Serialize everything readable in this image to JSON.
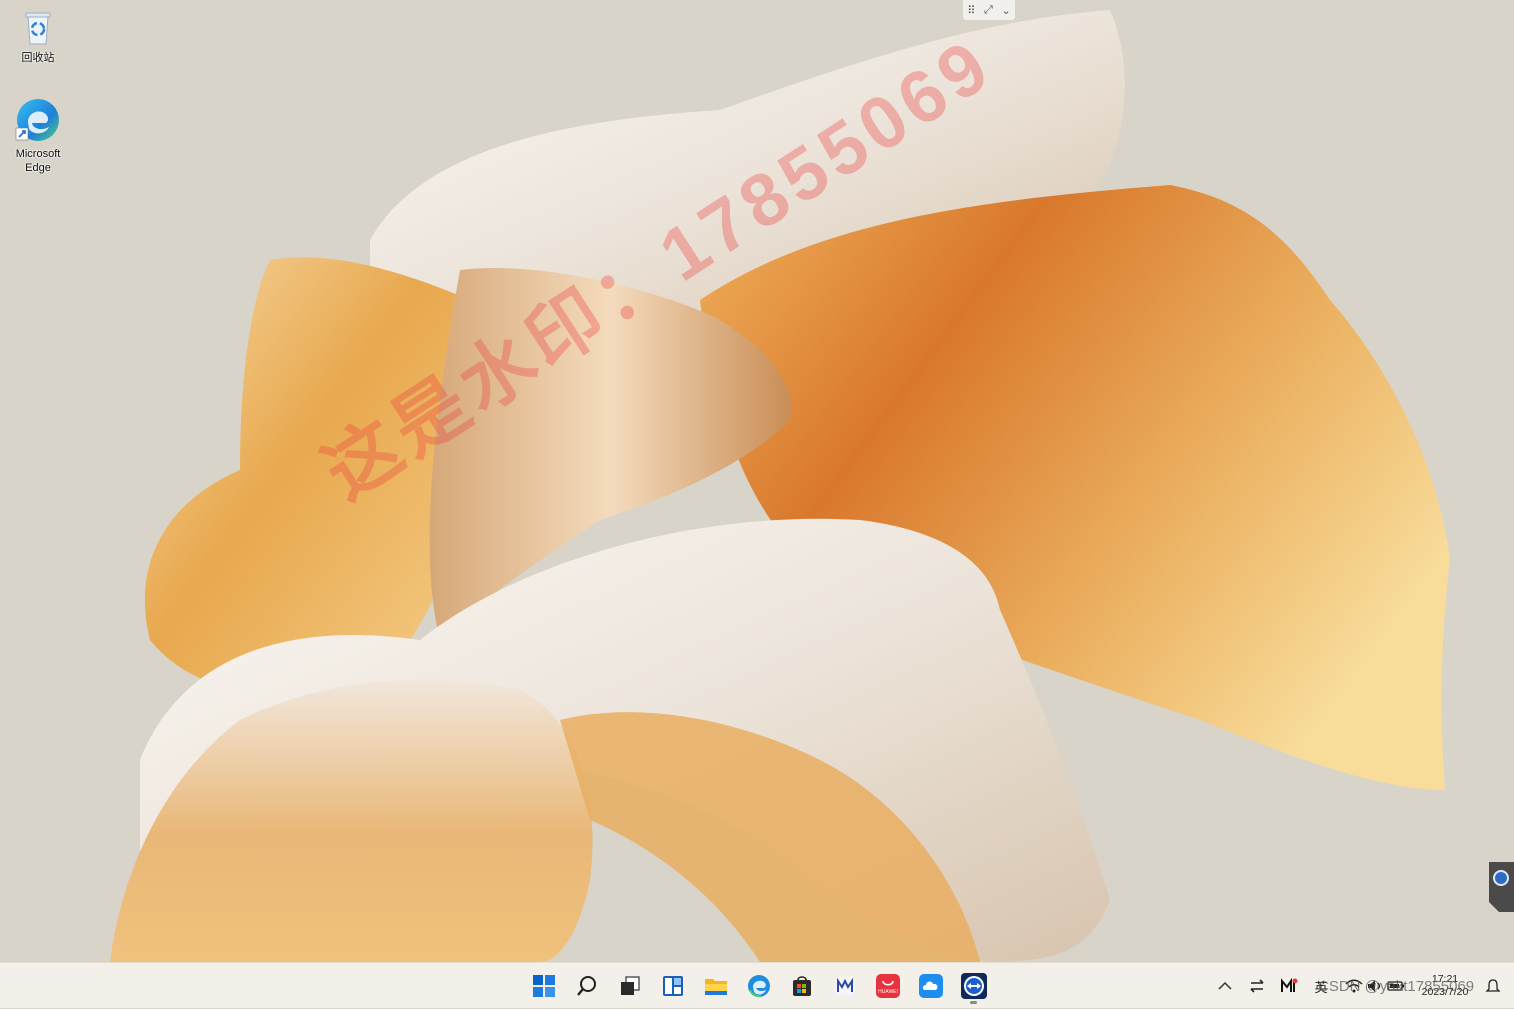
{
  "desktop": {
    "icons": [
      {
        "label": "回收站",
        "icon": "recycle-bin-icon"
      },
      {
        "label": "Microsoft\nEdge",
        "label_line1": "Microsoft",
        "label_line2": "Edge",
        "icon": "edge-icon"
      }
    ],
    "watermark_text": "这是水印：17855069",
    "wallpaper": "abstract-golden-petals"
  },
  "remote_bar": {
    "icons": [
      "grip-icon",
      "expand-icon",
      "chevron-down-icon"
    ]
  },
  "taskbar": {
    "apps": [
      {
        "name": "start",
        "icon": "windows-start-icon"
      },
      {
        "name": "search",
        "icon": "search-icon"
      },
      {
        "name": "task-view",
        "icon": "task-view-icon"
      },
      {
        "name": "widgets",
        "icon": "widgets-icon"
      },
      {
        "name": "file-explorer",
        "icon": "folder-icon"
      },
      {
        "name": "edge",
        "icon": "edge-icon"
      },
      {
        "name": "store",
        "icon": "store-icon"
      },
      {
        "name": "mail",
        "icon": "mail-app-icon"
      },
      {
        "name": "huawei-appgallery",
        "icon": "huawei-icon",
        "label": "HUAWEI"
      },
      {
        "name": "cloud",
        "icon": "cloud-icon"
      },
      {
        "name": "teamviewer",
        "icon": "teamviewer-icon",
        "running": true
      }
    ],
    "tray": {
      "show_hidden_icon": "chevron-up-icon",
      "items": [
        "transfer-icon",
        "gmail-icon"
      ],
      "ime": "英",
      "status_icons": [
        "wifi-icon",
        "volume-icon",
        "battery-icon"
      ],
      "time": "17:21",
      "date": "2023/7/20",
      "notification_icon": "notification-icon"
    }
  },
  "credit": "CSDN @yakt17855069",
  "colors": {
    "accent": "#0a64c8",
    "taskbar_bg": "#f3efe9",
    "desktop_bg": "#d8d4c9"
  }
}
